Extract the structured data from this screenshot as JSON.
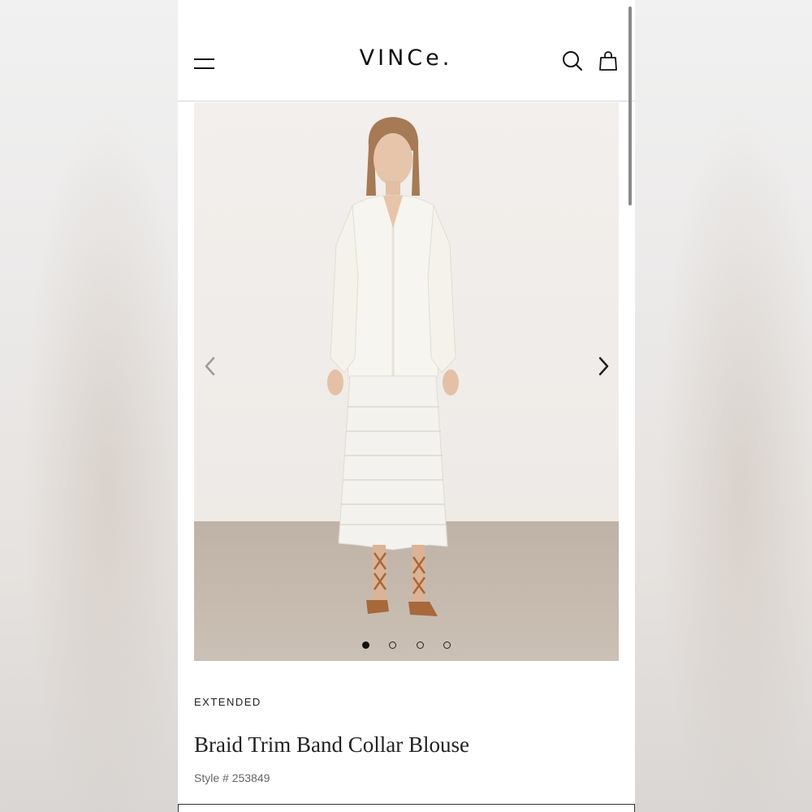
{
  "header": {
    "logo": "VINCe.",
    "menu_icon": "hamburger-menu-icon",
    "search_icon": "search-icon",
    "bag_icon": "shopping-bag-icon"
  },
  "gallery": {
    "prev_icon": "chevron-left-icon",
    "next_icon": "chevron-right-icon",
    "slide_count": 4,
    "active_slide": 1
  },
  "product": {
    "category": "EXTENDED",
    "name": "Braid Trim Band Collar Blouse",
    "style_number": "Style # 253849"
  },
  "colors": {
    "text": "#222222",
    "muted": "#666666",
    "background": "#ffffff"
  }
}
